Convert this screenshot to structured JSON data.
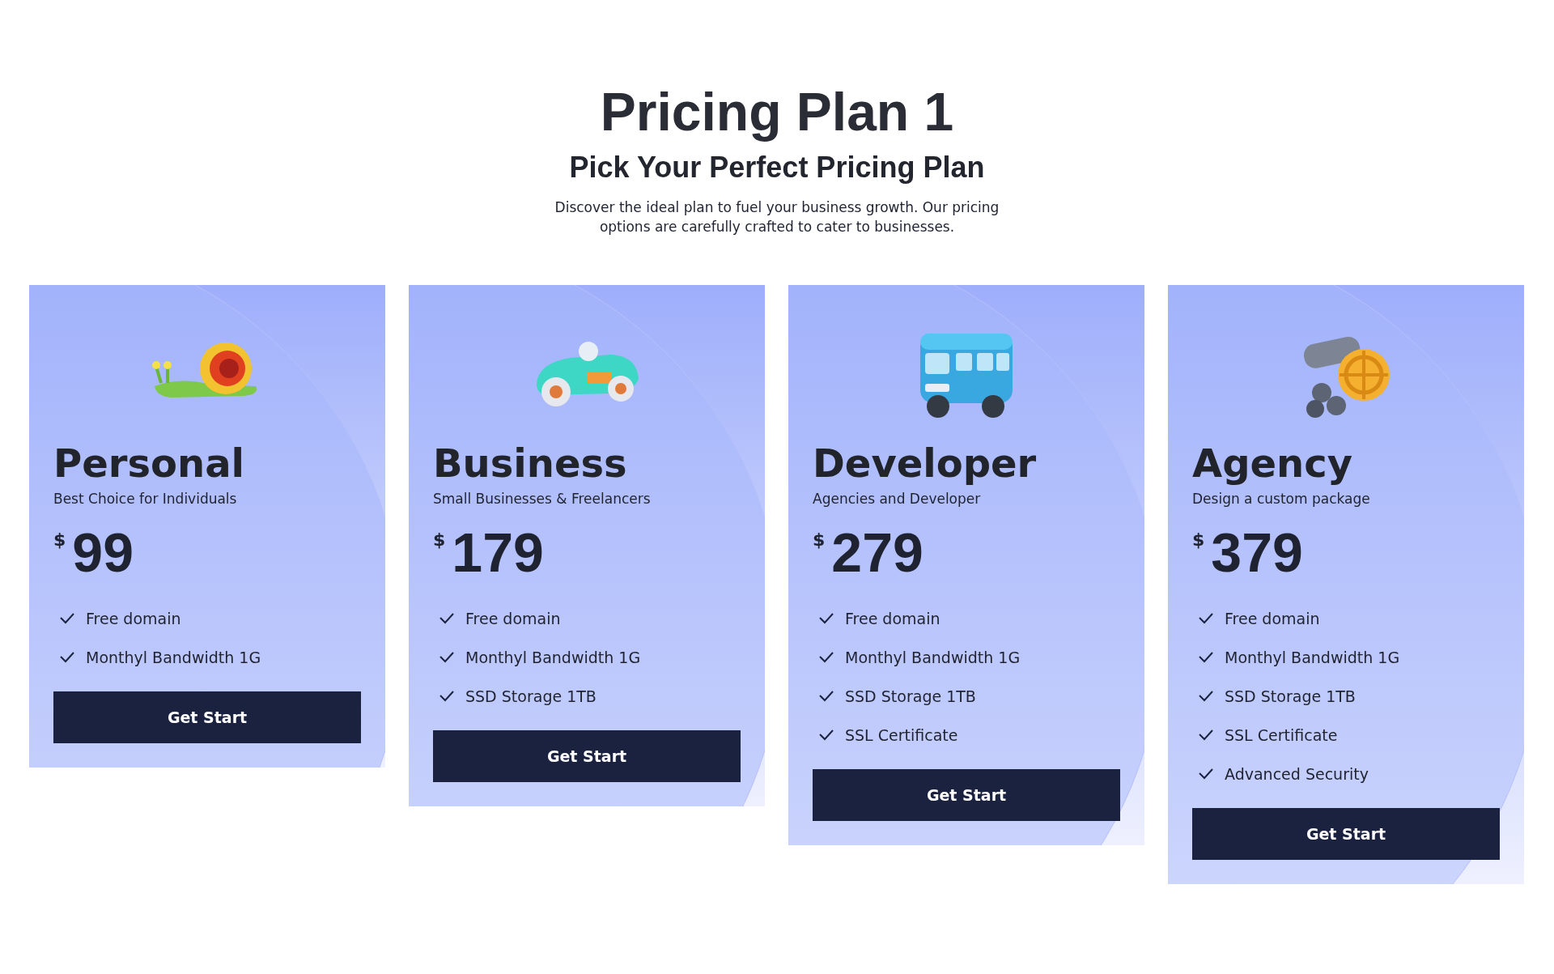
{
  "header": {
    "title": "Pricing Plan 1",
    "subtitle": "Pick Your Perfect Pricing Plan",
    "description": "Discover the ideal plan to fuel your business growth. Our pricing options are carefully crafted to cater to businesses."
  },
  "plans": [
    {
      "name": "Personal",
      "tagline": "Best Choice for Individuals",
      "currency": "$",
      "price": "99",
      "features": [
        "Free domain",
        "Monthyl Bandwidth 1G"
      ],
      "button": "Get Start"
    },
    {
      "name": "Business",
      "tagline": "Small Businesses & Freelancers",
      "currency": "$",
      "price": "179",
      "features": [
        "Free domain",
        "Monthyl Bandwidth 1G",
        "SSD Storage 1TB"
      ],
      "button": "Get Start"
    },
    {
      "name": "Developer",
      "tagline": "Agencies and Developer",
      "currency": "$",
      "price": "279",
      "features": [
        "Free domain",
        "Monthyl Bandwidth 1G",
        "SSD Storage 1TB",
        "SSL Certificate"
      ],
      "button": "Get Start"
    },
    {
      "name": "Agency",
      "tagline": "Design a custom package",
      "currency": "$",
      "price": "379",
      "features": [
        "Free domain",
        "Monthyl Bandwidth 1G",
        "SSD Storage 1TB",
        "SSL Certificate",
        "Advanced Security"
      ],
      "button": "Get Start"
    }
  ]
}
